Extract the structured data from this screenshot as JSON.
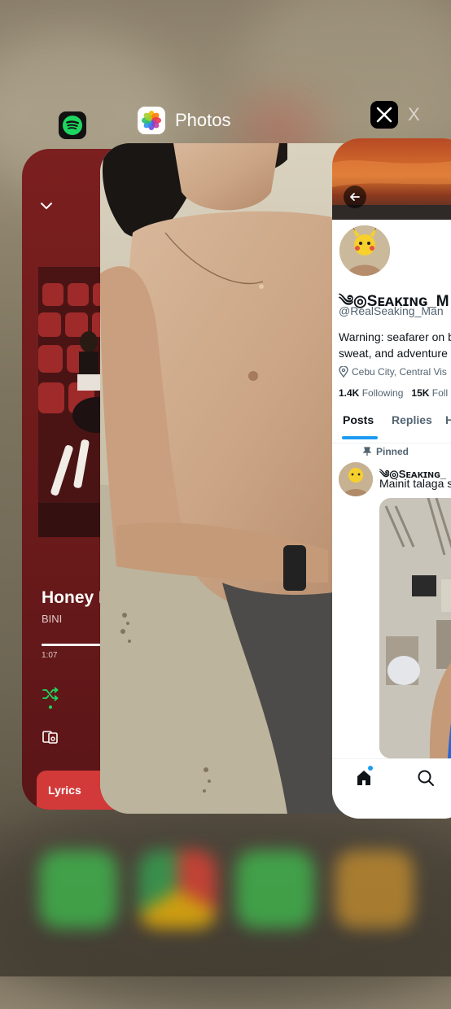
{
  "app_switcher": {
    "labels": [
      {
        "name": "",
        "icon": "spotify-icon"
      },
      {
        "name": "Photos",
        "icon": "photos-icon"
      },
      {
        "name": "X",
        "icon": "x-icon"
      }
    ]
  },
  "spotify": {
    "track_title": "Honey H",
    "artist": "BINI",
    "elapsed": "1:07",
    "progress": 0.45,
    "lyrics_label": "Lyrics",
    "accent": "#1ed760",
    "background": "#6b1a1b"
  },
  "x_profile": {
    "display_name": "༄◎Sᴇᴀᴋɪɴɢ_M",
    "handle": "@RealSeaking_Man",
    "bio_line1": "Warning: seafarer on b",
    "bio_line2": "sweat, and adventure",
    "location": "Cebu City, Central Vis",
    "following_count": "1.4K",
    "following_label": "Following",
    "followers_count": "15K",
    "followers_label": "Foll",
    "tabs": [
      "Posts",
      "Replies",
      "H"
    ],
    "pinned_label": "Pinned",
    "post_author": "༄◎Sᴇᴀᴋɪɴɢ_",
    "post_text": "Mainit talaga s",
    "accent": "#1d9bf0"
  }
}
